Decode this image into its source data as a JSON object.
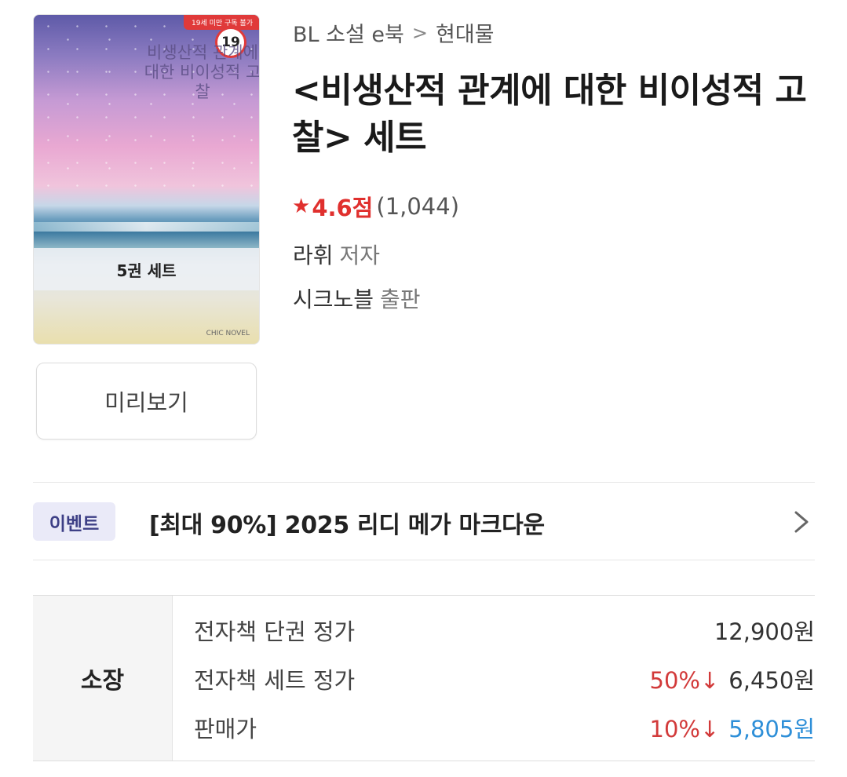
{
  "cover": {
    "age_banner": "19세 미만 구독 불가",
    "age_badge": "19",
    "title_art": "비생산적 관계에 대한 비이성적 고찰",
    "set_label": "5권 세트",
    "publisher_mark": "CHIC NOVEL"
  },
  "preview_button": "미리보기",
  "breadcrumb": {
    "category": "BL 소설 e북",
    "separator": ">",
    "subcategory": "현대물"
  },
  "book": {
    "title": "<비생산적 관계에 대한 비이성적 고찰> 세트",
    "rating": {
      "star": "★",
      "score": "4.6점",
      "count": "(1,044)"
    },
    "author": {
      "name": "라휘",
      "role": "저자"
    },
    "publisher": {
      "name": "시크노블",
      "role": "출판"
    }
  },
  "event": {
    "tag": "이벤트",
    "text": "[최대 90%] 2025 리디 메가 마크다운"
  },
  "price": {
    "side_label": "소장",
    "rows": [
      {
        "label": "전자책 단권 정가",
        "discount": "",
        "value": "12,900원"
      },
      {
        "label": "전자책 세트 정가",
        "discount": "50%",
        "value": "6,450원"
      },
      {
        "label": "판매가",
        "discount": "10%",
        "value": "5,805원"
      }
    ],
    "colors": {
      "discount": "#d23a3a",
      "final_price": "#2e8fd8"
    }
  }
}
